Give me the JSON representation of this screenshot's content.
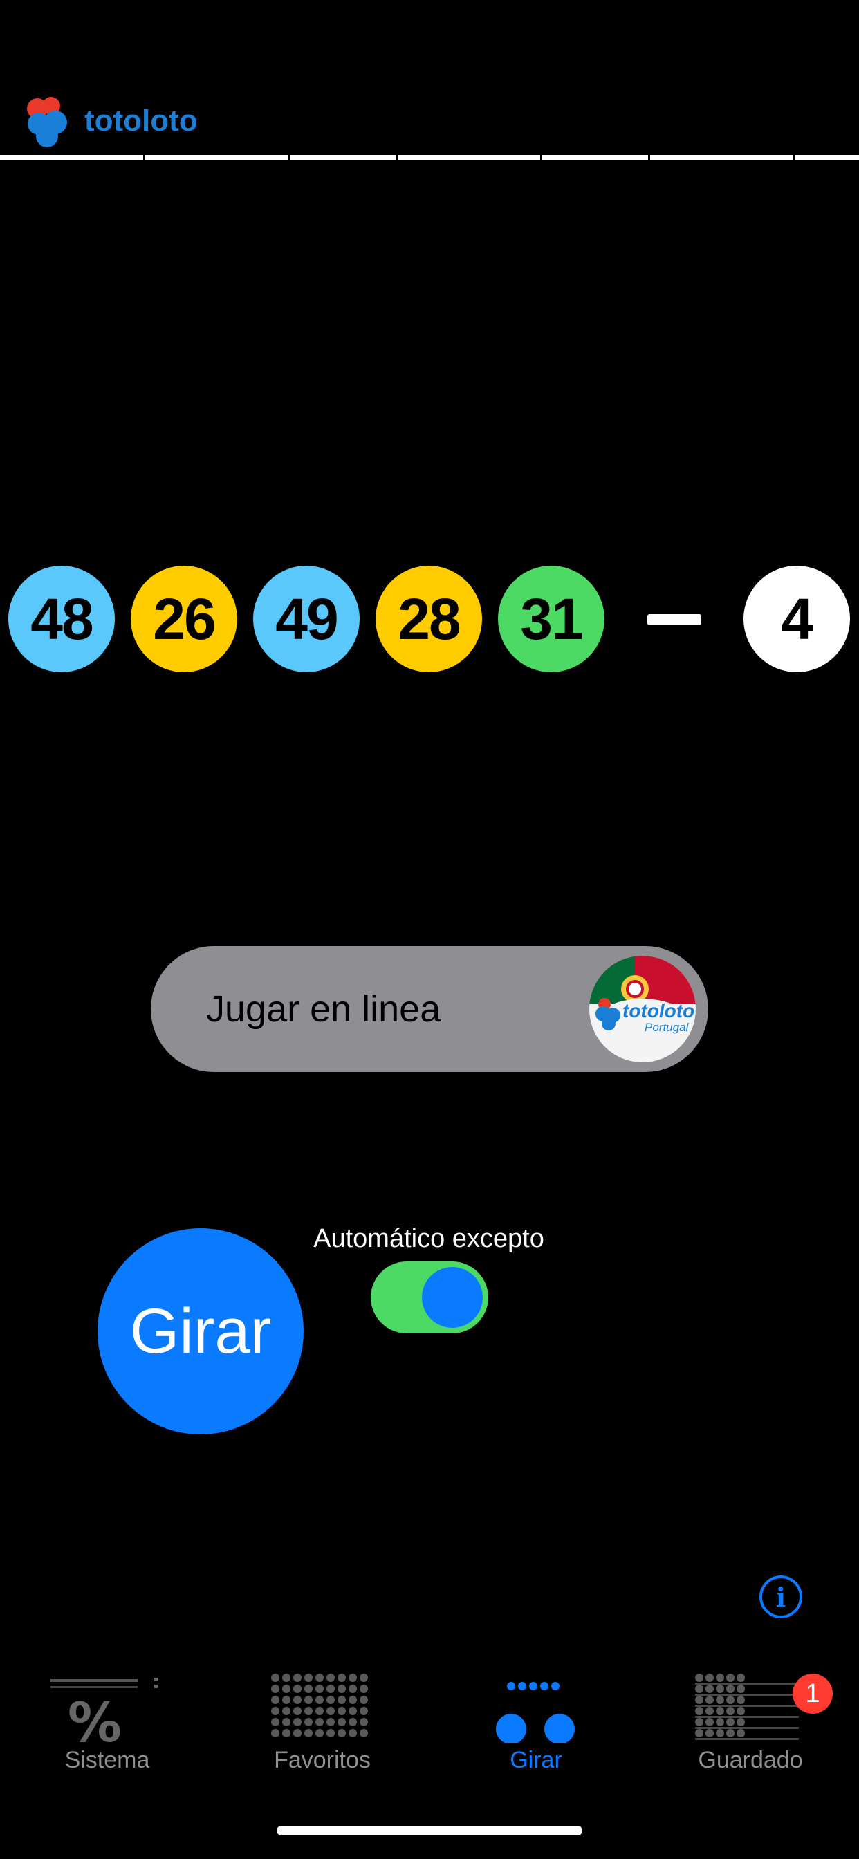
{
  "header": {
    "logo_text": "totoloto"
  },
  "draw": {
    "numbers": [
      {
        "value": "48",
        "color": "#5ac8fa"
      },
      {
        "value": "26",
        "color": "#ffcc00"
      },
      {
        "value": "49",
        "color": "#5ac8fa"
      },
      {
        "value": "28",
        "color": "#ffcc00"
      },
      {
        "value": "31",
        "color": "#4cd964"
      }
    ],
    "lucky_number": {
      "value": "4",
      "color": "#ffffff"
    }
  },
  "online": {
    "label": "Jugar en linea",
    "badge_logo": "totoloto",
    "badge_sub": "Portugal"
  },
  "spin": {
    "label": "Girar",
    "auto_label": "Automático excepto",
    "auto_enabled": true
  },
  "info_icon": "info-icon",
  "tabs": [
    {
      "label": "Sistema",
      "icon": "percent-icon",
      "active": false
    },
    {
      "label": "Favoritos",
      "icon": "grid-icon",
      "active": false
    },
    {
      "label": "Girar",
      "icon": "spin-dots-icon",
      "active": true
    },
    {
      "label": "Guardado",
      "icon": "saved-grid-icon",
      "active": false,
      "badge": "1"
    }
  ],
  "colors": {
    "accent": "#0a7aff",
    "toggle_on": "#4cd964",
    "badge": "#ff3b30"
  }
}
